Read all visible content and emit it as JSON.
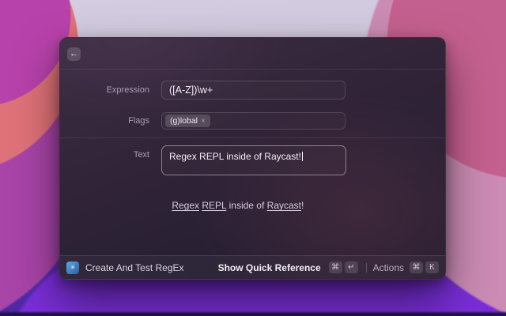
{
  "window": {
    "header": {
      "back_icon": "←"
    },
    "form": {
      "expression_label": "Expression",
      "expression_value": "([A-Z])\\w+",
      "flags_label": "Flags",
      "flags_tag": "(g)lobal",
      "flags_tag_remove": "×",
      "text_label": "Text",
      "text_value": "Regex REPL inside of Raycast!"
    },
    "output": {
      "segments": [
        {
          "text": "Regex",
          "match": true
        },
        {
          "text": " ",
          "match": false
        },
        {
          "text": "REPL",
          "match": true
        },
        {
          "text": " inside of ",
          "match": false
        },
        {
          "text": "Raycast",
          "match": true
        },
        {
          "text": "!",
          "match": false
        }
      ]
    },
    "footer": {
      "app_icon_glyph": "✳",
      "app_name": "Create And Test RegEx",
      "quick_reference_label": "Show Quick Reference",
      "quick_reference_keys": [
        "⌘",
        "↵"
      ],
      "actions_label": "Actions",
      "actions_keys": [
        "⌘",
        "K"
      ]
    }
  },
  "colors": {
    "window_background": "#2e2236",
    "footer_icon_gradient": [
      "#5aa7e8",
      "#2e5f9e"
    ],
    "wallpaper_accents": [
      "#c4608f",
      "#b842ab",
      "#df7278",
      "#7a2ed8"
    ],
    "match_underline": "#d4cdda"
  }
}
